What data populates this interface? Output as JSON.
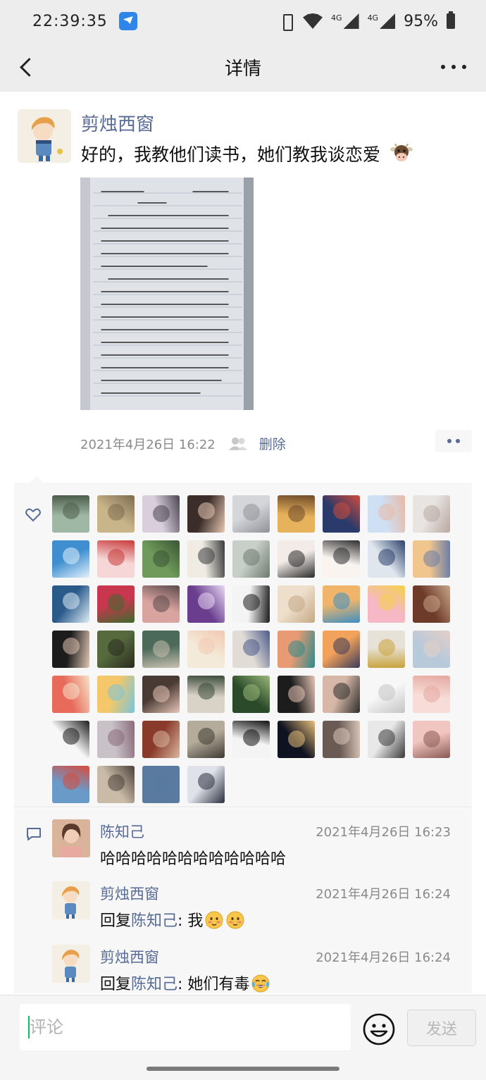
{
  "status_bar": {
    "time": "22:39:35",
    "network_1": "4G",
    "network_2": "4G",
    "battery": "95%"
  },
  "nav": {
    "title": "详情"
  },
  "post": {
    "author": "剪烛西窗",
    "text": "好的，我教他们读书，她们教我谈恋爱",
    "emoji": "cow-face-icon",
    "time": "2021年4月26日 16:22",
    "delete_label": "删除"
  },
  "likes": {
    "avatars": [
      {
        "c1": "#9fb7a5",
        "c2": "#4c5d4a"
      },
      {
        "c1": "#c9b58a",
        "c2": "#7b6a4e"
      },
      {
        "c1": "#d9cfdc",
        "c2": "#4a4451"
      },
      {
        "c1": "#3b2d2a",
        "c2": "#e7c8b3"
      },
      {
        "c1": "#d5d6da",
        "c2": "#8f9198"
      },
      {
        "c1": "#e7b25c",
        "c2": "#6d4a2a"
      },
      {
        "c1": "#2a3a6a",
        "c2": "#d14b3a"
      },
      {
        "c1": "#cfe0f5",
        "c2": "#e8b9a4"
      },
      {
        "c1": "#e8e4e2",
        "c2": "#b8a8a0"
      },
      {
        "c1": "#3f8fd0",
        "c2": "#e2f1fb"
      },
      {
        "c1": "#f6d6d6",
        "c2": "#c93a3a"
      },
      {
        "c1": "#6f9a5b",
        "c2": "#3a5433"
      },
      {
        "c1": "#f0ece4",
        "c2": "#3a3a3a"
      },
      {
        "c1": "#c8cfc8",
        "c2": "#6e7a70"
      },
      {
        "c1": "#f2ebe7",
        "c2": "#2a2a2a"
      },
      {
        "c1": "#f9f4ef",
        "c2": "#2d2d2d"
      },
      {
        "c1": "#dfe6ee",
        "c2": "#2a3f6a"
      },
      {
        "c1": "#f1c58e",
        "c2": "#6a7ea8"
      },
      {
        "c1": "#2a5a8a",
        "c2": "#dfeef7"
      },
      {
        "c1": "#c8374e",
        "c2": "#3d6b2e"
      },
      {
        "c1": "#d9a3a0",
        "c2": "#5a4a4a"
      },
      {
        "c1": "#6a3d8e",
        "c2": "#e7d9f2"
      },
      {
        "c1": "#f4f4f4",
        "c2": "#1c1c1c"
      },
      {
        "c1": "#eedfcc",
        "c2": "#c5a886"
      },
      {
        "c1": "#f0b56a",
        "c2": "#3d8fc4"
      },
      {
        "c1": "#f7b8c6",
        "c2": "#f2d24a"
      },
      {
        "c1": "#6e3b2a",
        "c2": "#c9a68a"
      },
      {
        "c1": "#1c1c1c",
        "c2": "#e1c5b2"
      },
      {
        "c1": "#566a3e",
        "c2": "#2a2a1e"
      },
      {
        "c1": "#4c6a5a",
        "c2": "#c7c0b0"
      },
      {
        "c1": "#f4ead9",
        "c2": "#f2c8b2"
      },
      {
        "c1": "#e2dcd7",
        "c2": "#4a5a8a"
      },
      {
        "c1": "#e89a74",
        "c2": "#2e8a8a"
      },
      {
        "c1": "#f2a25a",
        "c2": "#3a3a5a"
      },
      {
        "c1": "#e7e2d8",
        "c2": "#c9a23a"
      },
      {
        "c1": "#b8c9d9",
        "c2": "#e7cfc7"
      },
      {
        "c1": "#e76a5a",
        "c2": "#f7e2c8"
      },
      {
        "c1": "#f4c86a",
        "c2": "#7ac4d9"
      },
      {
        "c1": "#4a3a34",
        "c2": "#e7c6b8"
      },
      {
        "c1": "#d9d2c6",
        "c2": "#3a4a3a"
      },
      {
        "c1": "#2a4a2a",
        "c2": "#9ab87a"
      },
      {
        "c1": "#1c1c1c",
        "c2": "#e7c6b8"
      },
      {
        "c1": "#d7b8a8",
        "c2": "#2c2c2c"
      },
      {
        "c1": "#f7f7f7",
        "c2": "#c4c4c4"
      },
      {
        "c1": "#f7dcd7",
        "c2": "#e5a8a0"
      },
      {
        "c1": "#f7f7f7",
        "c2": "#1c1c1c"
      },
      {
        "c1": "#c8c2c8",
        "c2": "#8a6a7a"
      },
      {
        "c1": "#8a3a2a",
        "c2": "#d9b8a0"
      },
      {
        "c1": "#b5ab9a",
        "c2": "#3e3a33"
      },
      {
        "c1": "#f4f4f4",
        "c2": "#111111"
      },
      {
        "c1": "#0f1220",
        "c2": "#e8c07a"
      },
      {
        "c1": "#6a5a54",
        "c2": "#d9c6b8"
      },
      {
        "c1": "#e8e8e8",
        "c2": "#3a3a3a"
      },
      {
        "c1": "#f2c6c0",
        "c2": "#8a5a54"
      },
      {
        "c1": "#6a9ac8",
        "c2": "#d94a3a"
      },
      {
        "c1": "#c9bba8",
        "c2": "#4a4038"
      },
      {
        "c1": "#5a7aa0",
        "c2": "#5a7aa0"
      },
      {
        "c1": "#dfe2e8",
        "c2": "#2a3040"
      }
    ]
  },
  "comments": [
    {
      "name": "陈知己",
      "time": "2021年4月26日 16:23",
      "text": "哈哈哈哈哈哈哈哈哈哈哈哈",
      "reply_prefix": "",
      "reply_to": "",
      "emoji": ""
    },
    {
      "name": "剪烛西窗",
      "time": "2021年4月26日 16:24",
      "reply_prefix": "回复",
      "reply_to": "陈知己",
      "text": ": 我",
      "emoji": "blushing-face-icon"
    },
    {
      "name": "剪烛西窗",
      "time": "2021年4月26日 16:24",
      "reply_prefix": "回复",
      "reply_to": "陈知己",
      "text": ": 她们有毒",
      "emoji": "tears-of-joy-icon"
    }
  ],
  "input": {
    "placeholder": "评论",
    "send_label": "发送"
  }
}
